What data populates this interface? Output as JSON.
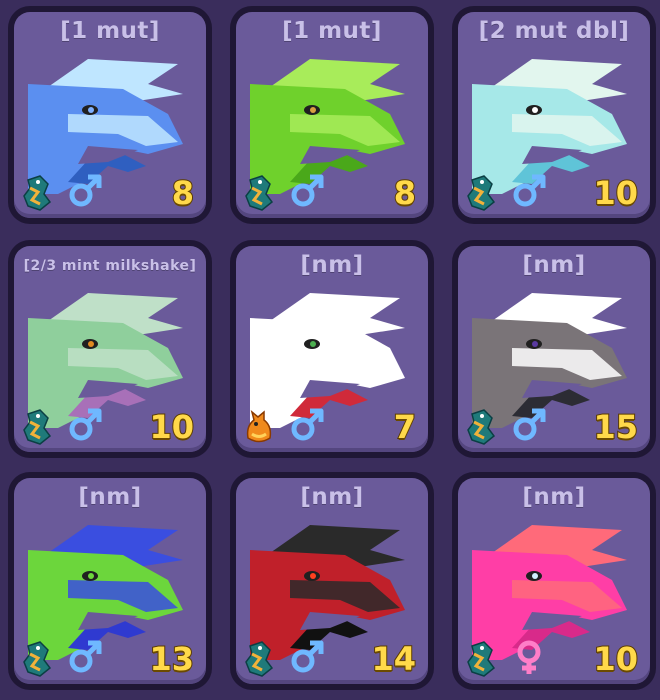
{
  "pets": [
    {
      "tag": "[1 mut]",
      "level": "8",
      "gender": "male",
      "species": "sea-dragon",
      "colors": {
        "main": "#5b8ff0",
        "light": "#bfe6ff",
        "dark": "#2f5fc0",
        "eye": "#7fb0ff"
      }
    },
    {
      "tag": "[1 mut]",
      "level": "8",
      "gender": "male",
      "species": "sea-dragon",
      "colors": {
        "main": "#6fd12c",
        "light": "#a8ec5a",
        "dark": "#4aa81a",
        "eye": "#d8a040"
      }
    },
    {
      "tag": "[2 mut dbl]",
      "level": "10",
      "gender": "male",
      "species": "sea-dragon",
      "colors": {
        "main": "#a6e8e8",
        "light": "#e2f6ee",
        "dark": "#5fc4d8",
        "eye": "#ffffff"
      }
    },
    {
      "tag": "[2/3 mint milkshake]",
      "level": "10",
      "gender": "male",
      "species": "sea-dragon",
      "colors": {
        "main": "#8fcf9c",
        "light": "#bfe0c8",
        "dark": "#a870b8",
        "eye": "#e08a20"
      }
    },
    {
      "tag": "[nm]",
      "level": "7",
      "gender": "male",
      "species": "fire-dragon",
      "colors": {
        "main": "#ffffff",
        "light": "#ffffff",
        "dark": "#d02a3a",
        "eye": "#4caf50"
      }
    },
    {
      "tag": "[nm]",
      "level": "15",
      "gender": "male",
      "species": "sea-dragon",
      "colors": {
        "main": "#7a7478",
        "light": "#ffffff",
        "dark": "#2c2c34",
        "eye": "#5a3aa0"
      }
    },
    {
      "tag": "[nm]",
      "level": "13",
      "gender": "male",
      "species": "sea-dragon",
      "colors": {
        "main": "#6cd63c",
        "light": "#3a4ee0",
        "dark": "#2f3ad0",
        "eye": "#6cd63c"
      }
    },
    {
      "tag": "[nm]",
      "level": "14",
      "gender": "male",
      "species": "sea-dragon",
      "colors": {
        "main": "#c0202a",
        "light": "#2a2a2a",
        "dark": "#111111",
        "eye": "#ff4020"
      }
    },
    {
      "tag": "[nm]",
      "level": "10",
      "gender": "female",
      "species": "sea-dragon",
      "colors": {
        "main": "#ff3ea6",
        "light": "#ff6a7a",
        "dark": "#d82a8a",
        "eye": "#d0f0ff"
      }
    }
  ]
}
